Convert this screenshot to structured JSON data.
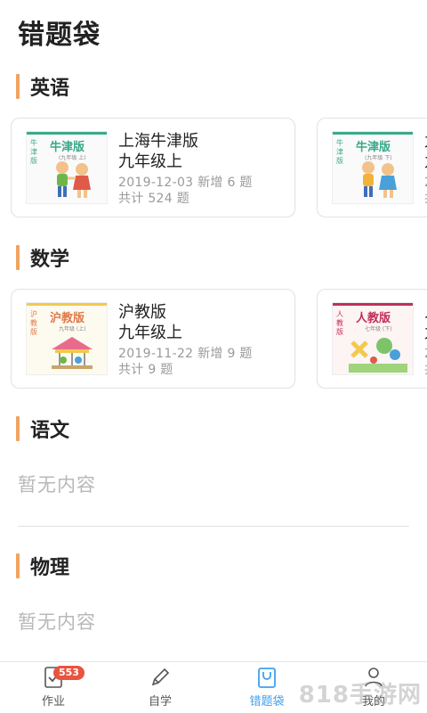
{
  "page": {
    "title": "错题袋"
  },
  "sections": {
    "english": {
      "title": "英语",
      "cards": [
        {
          "cover_title": "牛津版",
          "cover_side": "牛津版",
          "cover_sub": "(九年级 上)",
          "name": "上海牛津版",
          "grade": "九年级上",
          "meta": "2019-12-03 新增 6 题",
          "total": "共计 524 题"
        },
        {
          "cover_title": "牛津版",
          "cover_side": "牛津版",
          "cover_sub": "(九年级 下)",
          "name": "九",
          "grade": "九",
          "meta": "2",
          "total": "共"
        }
      ]
    },
    "math": {
      "title": "数学",
      "cards": [
        {
          "cover_title": "沪教版",
          "cover_side": "沪教版",
          "cover_sub": "九年级 (上)",
          "name": "沪教版",
          "grade": "九年级上",
          "meta": "2019-11-22 新增 9 题",
          "total": "共计 9 题"
        },
        {
          "cover_title": "人教版",
          "cover_side": "人教版",
          "cover_sub": "七年级 (下)",
          "name": "人",
          "grade": "九",
          "meta": "2",
          "total": "共"
        }
      ]
    },
    "chinese": {
      "title": "语文",
      "empty": "暂无内容"
    },
    "physics": {
      "title": "物理",
      "empty": "暂无内容"
    }
  },
  "nav": {
    "items": [
      {
        "label": "作业",
        "badge": "553"
      },
      {
        "label": "自学"
      },
      {
        "label": "错题袋"
      },
      {
        "label": "我的"
      }
    ]
  },
  "watermark": "818手游网",
  "colors": {
    "accent": "#f0a460",
    "active": "#3fa0f0",
    "badge": "#e8543f"
  }
}
